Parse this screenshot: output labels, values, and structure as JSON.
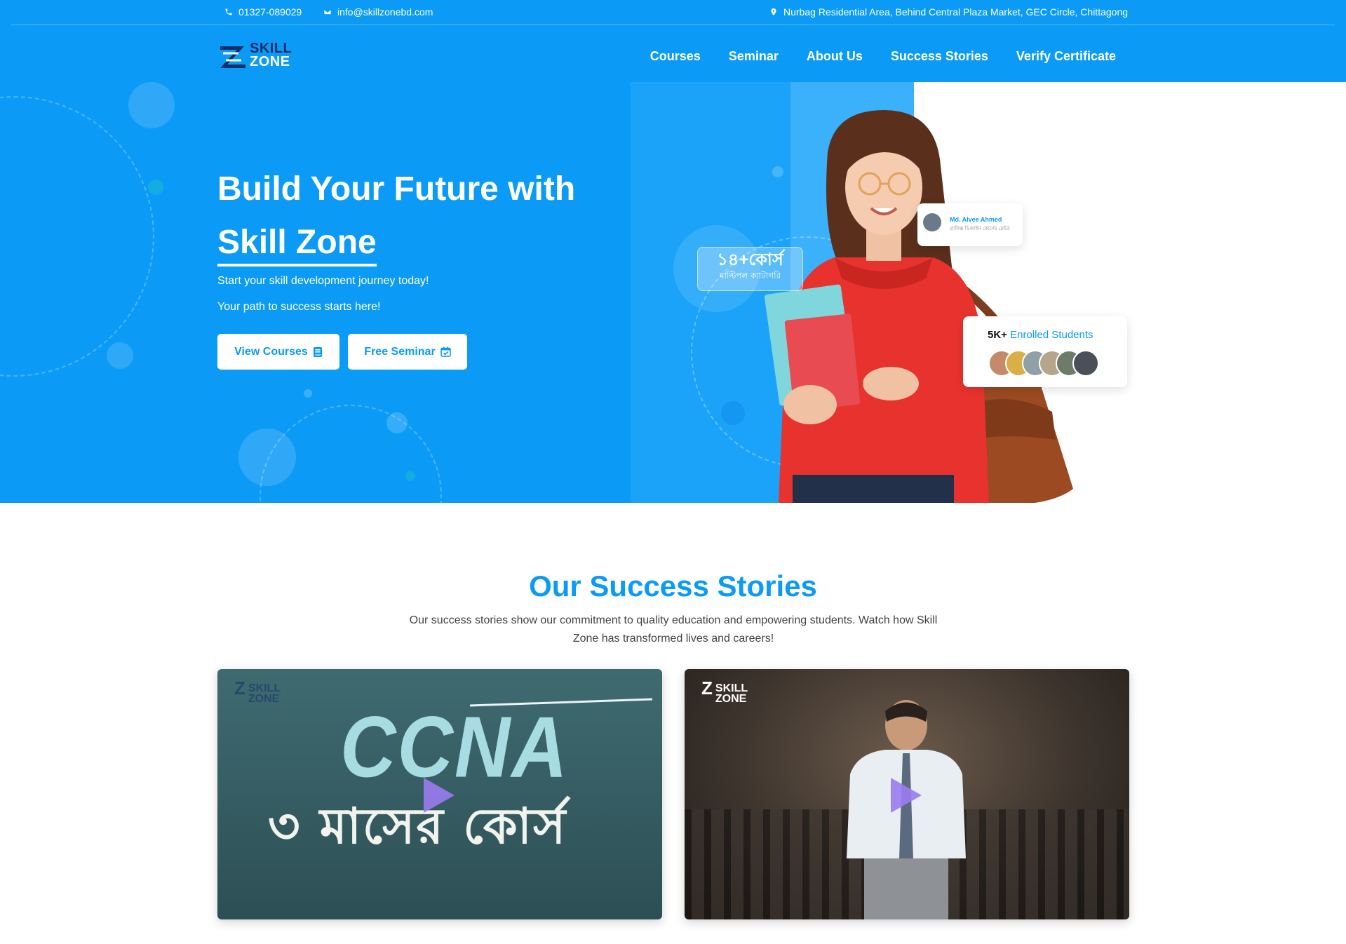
{
  "topbar": {
    "phone": "01327-089029",
    "email": "info@skillzonebd.com",
    "address": "Nurbag Residential Area, Behind Central Plaza Market, GEC Circle, Chittagong"
  },
  "header": {
    "logo_line1": "SKILL",
    "logo_line2": "ZONE",
    "nav": [
      "Courses",
      "Seminar",
      "About Us",
      "Success Stories",
      "Verify Certificate"
    ]
  },
  "hero": {
    "title_line1": "Build Your Future with",
    "title_brand": "Skill Zone",
    "subtitle1": "Start your skill development journey today!",
    "subtitle2": "Your path to success starts here!",
    "btn_courses": "View Courses",
    "btn_seminar": "Free Seminar",
    "badge_courses_value": "১৪+কোর্স",
    "badge_courses_label": "মাল্টিপল ক্যাটাগরি",
    "instructor_name": "Md. Alvee Ahmed",
    "instructor_desc": "গ্রাফিক্স ডিজাইন কোর্সের মেন্টর",
    "students_count": "5K+",
    "students_label": "Enrolled Students"
  },
  "success": {
    "title": "Our Success Stories",
    "description": "Our success stories show our commitment to quality education and empowering students. Watch how Skill Zone has transformed lives and careers!",
    "video1_logo_line1": "SKILL",
    "video1_logo_line2": "ZONE",
    "video1_heading": "CCNA",
    "video1_subheading": "৩ মাসের কোর্স",
    "video2_logo_line1": "SKILL",
    "video2_logo_line2": "ZONE"
  },
  "colors": {
    "primary": "#0b9bf6",
    "navy": "#0d2d6b",
    "white": "#ffffff"
  },
  "icons": {
    "phone": "phone-icon",
    "email": "envelope-icon",
    "address": "map-pin-icon",
    "courses_btn": "book-icon",
    "seminar_btn": "calendar-check-icon",
    "video_play": "play-icon"
  }
}
